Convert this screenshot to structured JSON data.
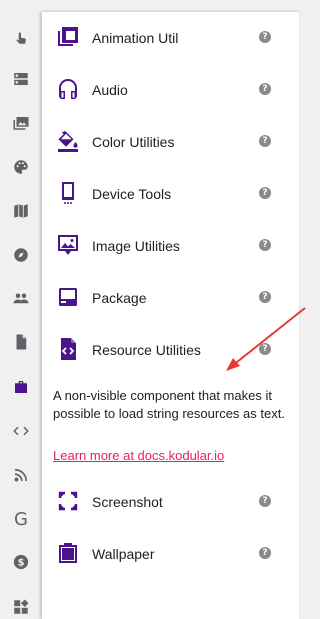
{
  "sidebar": {
    "icons": [
      {
        "name": "user-interface-icon"
      },
      {
        "name": "layout-icon"
      },
      {
        "name": "media-icon"
      },
      {
        "name": "drawing-icon"
      },
      {
        "name": "maps-icon"
      },
      {
        "name": "sensors-icon"
      },
      {
        "name": "social-icon"
      },
      {
        "name": "storage-icon"
      },
      {
        "name": "utilities-icon",
        "active": true
      },
      {
        "name": "connectivity-icon"
      },
      {
        "name": "feed-icon"
      },
      {
        "name": "google-icon",
        "glyph": "G"
      },
      {
        "name": "monetization-icon"
      },
      {
        "name": "extensions-icon"
      }
    ]
  },
  "components": [
    {
      "label": "Animation Util",
      "icon": "copy-icon"
    },
    {
      "label": "Audio",
      "icon": "headset-icon"
    },
    {
      "label": "Color Utilities",
      "icon": "paint-bucket-icon"
    },
    {
      "label": "Device Tools",
      "icon": "phone-icon"
    },
    {
      "label": "Image Utilities",
      "icon": "image-frame-icon"
    },
    {
      "label": "Package",
      "icon": "package-icon"
    },
    {
      "label": "Resource Utilities",
      "icon": "code-file-icon"
    },
    {
      "label": "Screenshot",
      "icon": "screenshot-icon"
    },
    {
      "label": "Wallpaper",
      "icon": "wallpaper-icon"
    }
  ],
  "help_glyph": "?",
  "description": {
    "text": "A non-visible component that makes it possible to load string resources as text.",
    "link": "Learn more at docs.kodular.io"
  },
  "colors": {
    "accent": "#4a148c",
    "link": "#e91e63",
    "annotation_arrow": "#e53935"
  }
}
